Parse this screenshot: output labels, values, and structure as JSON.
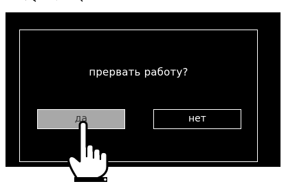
{
  "dialog": {
    "prompt": "прервать работу?",
    "buttons": {
      "yes_label": "да",
      "no_label": "нет"
    },
    "selected_button": "yes"
  },
  "icons": {
    "pointer": "pointing-hand-icon"
  },
  "colors": {
    "screen_background": "#000000",
    "frame_border": "#ffffff",
    "selected_button_fill": "#a8a8a8",
    "text": "#ffffff"
  }
}
